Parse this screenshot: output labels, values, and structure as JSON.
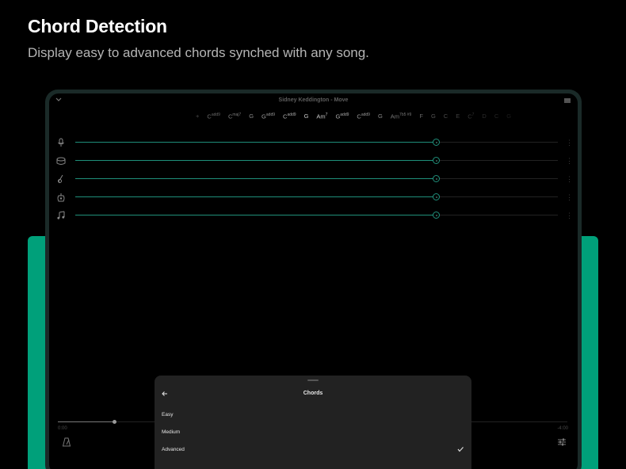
{
  "header": {
    "title": "Chord Detection",
    "subtitle": "Display easy to advanced chords synched with any song."
  },
  "colors": {
    "accent": "#00a07a",
    "track_line": "#1f8f7a",
    "device_frame": "#1a2a28",
    "sheet_bg": "#222222"
  },
  "app": {
    "song_title": "Sidney Keddington - Move",
    "chords": [
      {
        "root": "+",
        "sup": "",
        "color": "#4a4a4a"
      },
      {
        "root": "C",
        "sup": "add9",
        "color": "#6a6a6a"
      },
      {
        "root": "C",
        "sup": "maj7",
        "color": "#7a7a7a"
      },
      {
        "root": "G",
        "sup": "",
        "color": "#888888"
      },
      {
        "root": "G",
        "sup": "add9",
        "color": "#999999"
      },
      {
        "root": "C",
        "sup": "add9",
        "color": "#aaaaaa"
      },
      {
        "root": "G",
        "sup": "",
        "color": "#c8c8c8"
      },
      {
        "root": "Am",
        "sup": "7",
        "color": "#c8c8c8"
      },
      {
        "root": "G",
        "sup": "add9",
        "color": "#aaaaaa"
      },
      {
        "root": "C",
        "sup": "add9",
        "color": "#999999"
      },
      {
        "root": "G",
        "sup": "",
        "color": "#888888"
      },
      {
        "root": "Am",
        "sup": "7b5 #9",
        "color": "#777777"
      },
      {
        "root": "F",
        "sup": "",
        "color": "#666666"
      },
      {
        "root": "G",
        "sup": "",
        "color": "#555555"
      },
      {
        "root": "C",
        "sup": "",
        "color": "#4a4a4a"
      },
      {
        "root": "E",
        "sup": "",
        "color": "#404040"
      },
      {
        "root": "C",
        "sup": "7",
        "color": "#353535"
      },
      {
        "root": "D",
        "sup": "",
        "color": "#2c2c2c"
      },
      {
        "root": "C",
        "sup": "",
        "color": "#242424"
      },
      {
        "root": "G",
        "sup": "",
        "color": "#1c1c1c"
      }
    ],
    "tracks": [
      {
        "name": "vocals",
        "icon": "microphone-icon",
        "level": 0.72
      },
      {
        "name": "drums",
        "icon": "drum-icon",
        "level": 0.72
      },
      {
        "name": "bass",
        "icon": "bass-guitar-icon",
        "level": 0.72
      },
      {
        "name": "guitar",
        "icon": "guitar-icon",
        "level": 0.72
      },
      {
        "name": "other",
        "icon": "music-note-icon",
        "level": 0.72
      }
    ],
    "playback": {
      "position": 0.11,
      "time_start": "0:00",
      "time_end": "-4:00"
    }
  },
  "sheet": {
    "title": "Chords",
    "options": [
      {
        "label": "Easy",
        "selected": false
      },
      {
        "label": "Medium",
        "selected": false
      },
      {
        "label": "Advanced",
        "selected": true
      }
    ]
  }
}
